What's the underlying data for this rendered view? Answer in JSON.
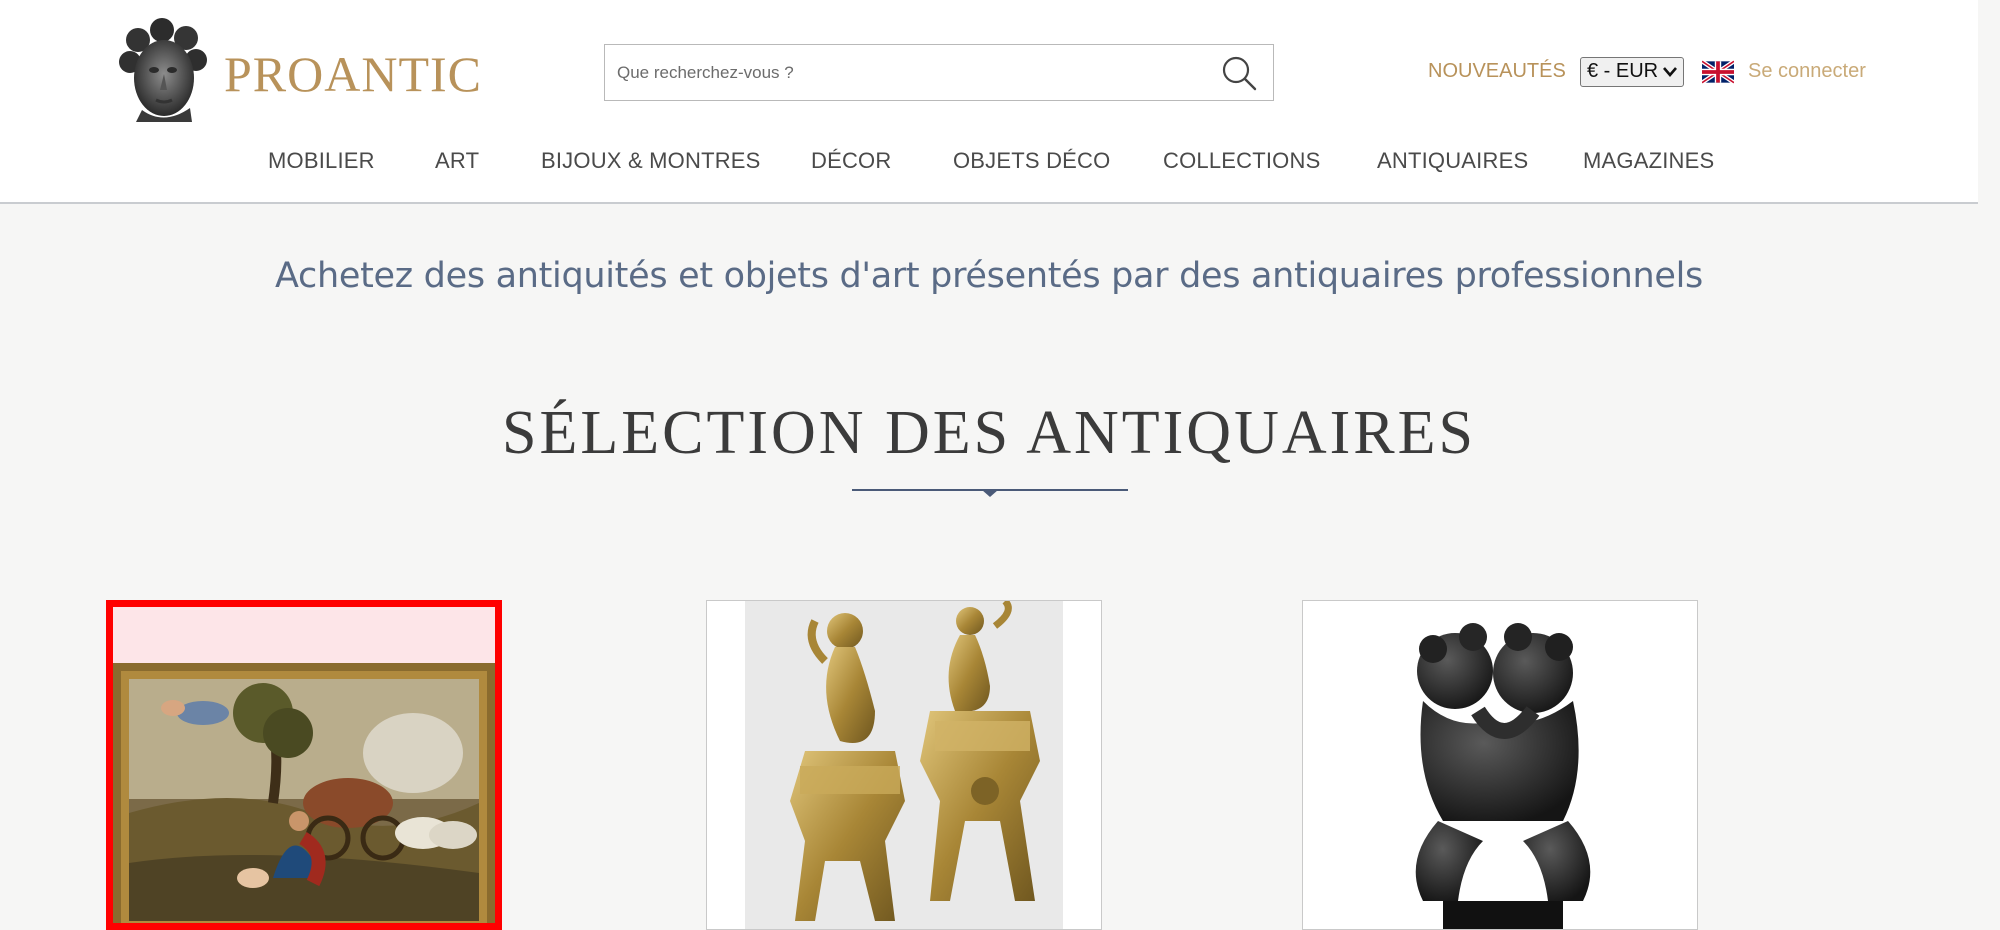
{
  "header": {
    "brand": "PROANTIC",
    "search_placeholder": "Que recherchez-vous ?",
    "new_items": "NOUVEAUTÉS",
    "currency": "€ - EUR",
    "language_flag": "uk-flag-icon",
    "login": "Se connecter"
  },
  "nav": {
    "items": [
      "MOBILIER",
      "ART",
      "BIJOUX & MONTRES",
      "DÉCOR",
      "OBJETS DÉCO",
      "COLLECTIONS",
      "ANTIQUAIRES",
      "MAGAZINES"
    ]
  },
  "tagline": "Achetez des antiquités et objets d'art présentés par des antiquaires professionnels",
  "section": {
    "title": "SÉLECTION DES ANTIQUAIRES"
  },
  "products": [
    {
      "image": "painting-image",
      "selected": true
    },
    {
      "image": "bronze-chenets-image",
      "selected": false
    },
    {
      "image": "bronze-putti-sculpture-image",
      "selected": false
    }
  ],
  "colors": {
    "brand": "#b8925a",
    "tagline": "#5a6b86",
    "selection": "#ff0000",
    "background": "#f6f6f5"
  }
}
